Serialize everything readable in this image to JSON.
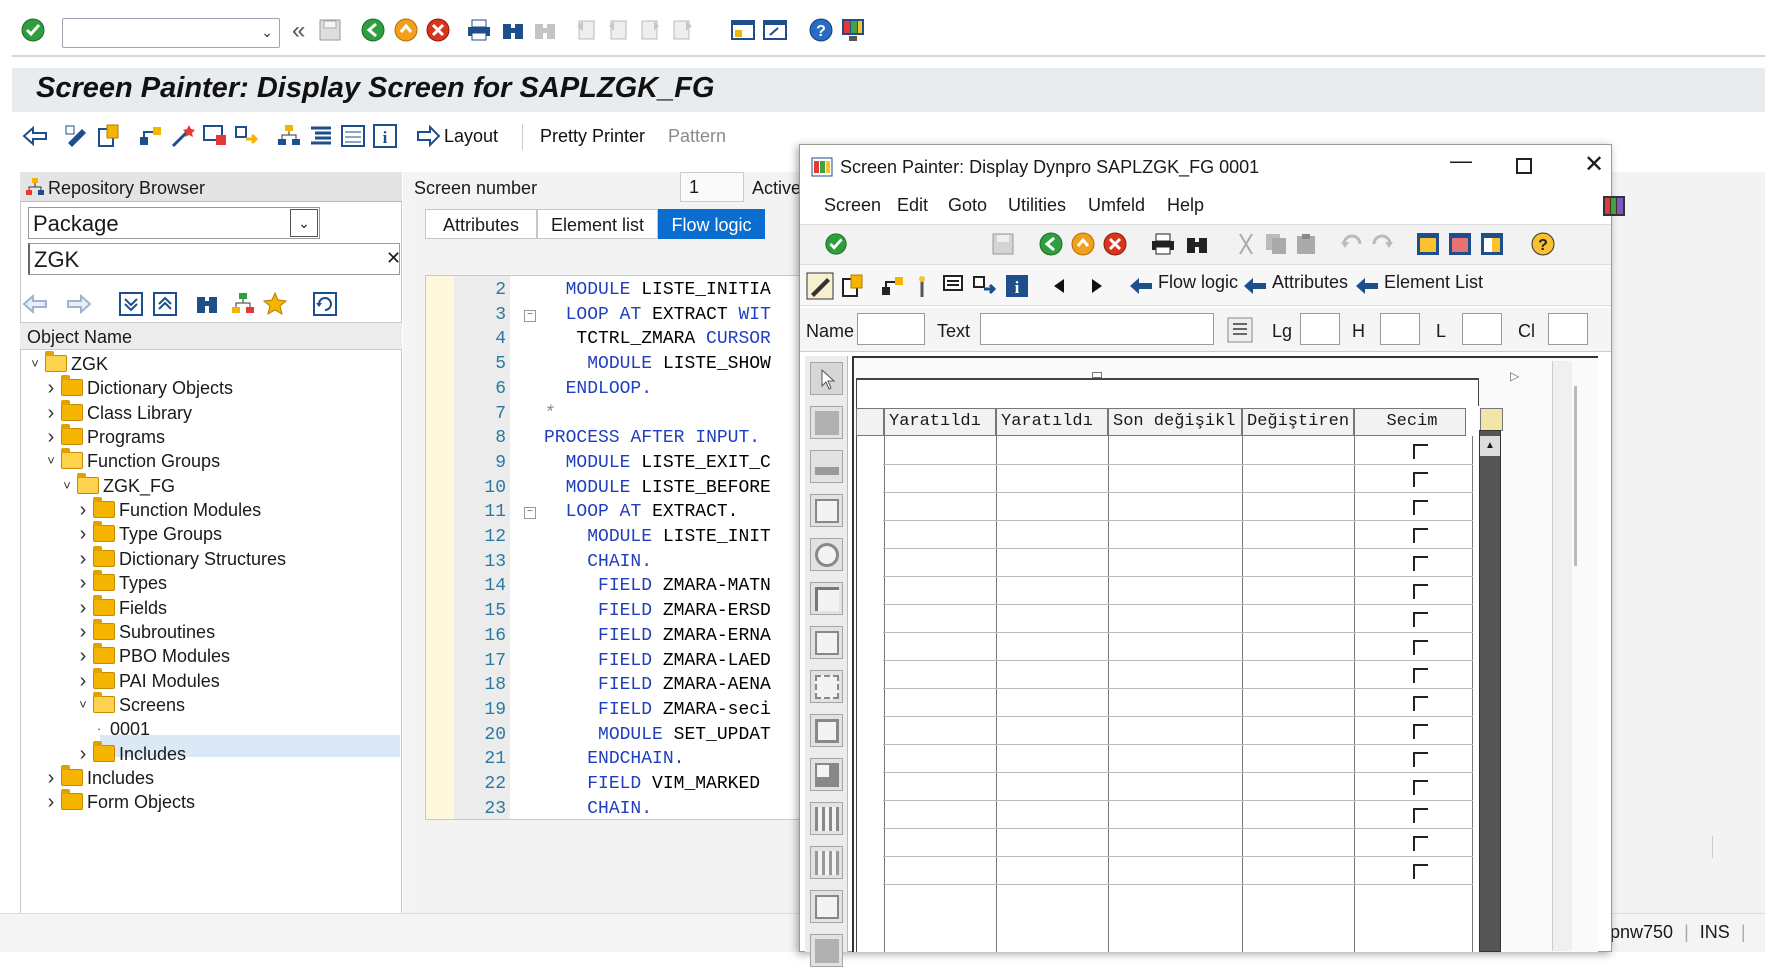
{
  "system_toolbar": {
    "command_field_value": "",
    "icons": [
      "enter-icon",
      "history-back-icon",
      "save-icon",
      "back-icon",
      "exit-icon",
      "cancel-icon",
      "print-icon",
      "find-icon",
      "find-next-icon",
      "first-page-icon",
      "prev-page-icon",
      "next-page-icon",
      "last-page-icon",
      "new-session-icon",
      "shortcut-icon",
      "help-icon",
      "layout-icon"
    ]
  },
  "title": "Screen Painter: Display Screen for SAPLZGK_FG",
  "app_toolbar": {
    "layout_label": "Layout",
    "pretty_printer_label": "Pretty Printer",
    "pattern_label": "Pattern"
  },
  "left_panel": {
    "header": "Repository Browser",
    "object_type": "Package",
    "object_name_value": "ZGK",
    "tree_header": "Object Name",
    "tree": [
      {
        "label": "ZGK",
        "level": 0,
        "expanded": true,
        "folder": true
      },
      {
        "label": "Dictionary Objects",
        "level": 1,
        "expanded": false,
        "folder": true
      },
      {
        "label": "Class Library",
        "level": 1,
        "expanded": false,
        "folder": true
      },
      {
        "label": "Programs",
        "level": 1,
        "expanded": false,
        "folder": true
      },
      {
        "label": "Function Groups",
        "level": 1,
        "expanded": true,
        "folder": true
      },
      {
        "label": "ZGK_FG",
        "level": 2,
        "expanded": true,
        "folder": true
      },
      {
        "label": "Function Modules",
        "level": 3,
        "expanded": false,
        "folder": true
      },
      {
        "label": "Type Groups",
        "level": 3,
        "expanded": false,
        "folder": true
      },
      {
        "label": "Dictionary Structures",
        "level": 3,
        "expanded": false,
        "folder": true
      },
      {
        "label": "Types",
        "level": 3,
        "expanded": false,
        "folder": true
      },
      {
        "label": "Fields",
        "level": 3,
        "expanded": false,
        "folder": true
      },
      {
        "label": "Subroutines",
        "level": 3,
        "expanded": false,
        "folder": true
      },
      {
        "label": "PBO Modules",
        "level": 3,
        "expanded": false,
        "folder": true
      },
      {
        "label": "PAI Modules",
        "level": 3,
        "expanded": false,
        "folder": true
      },
      {
        "label": "Screens",
        "level": 3,
        "expanded": true,
        "folder": true
      },
      {
        "label": "0001",
        "level": 4,
        "expanded": null,
        "folder": false,
        "selected": true
      },
      {
        "label": "Includes",
        "level": 3,
        "expanded": false,
        "folder": true
      },
      {
        "label": "Includes",
        "level": 1,
        "expanded": false,
        "folder": true
      },
      {
        "label": "Form Objects",
        "level": 1,
        "expanded": false,
        "folder": true
      }
    ]
  },
  "editor": {
    "screen_number_label": "Screen number",
    "screen_number_value": "1",
    "status_label": "Active",
    "tabs": [
      {
        "label": "Attributes",
        "selected": false
      },
      {
        "label": "Element list",
        "selected": false
      },
      {
        "label": "Flow logic",
        "selected": true
      }
    ],
    "lines": [
      {
        "n": "2",
        "text": "  MODULE LISTE_INITIA",
        "fold": false
      },
      {
        "n": "3",
        "text": "  LOOP AT EXTRACT WIT",
        "fold": true
      },
      {
        "n": "4",
        "text": "   TCTRL_ZMARA CURSOR",
        "fold": false
      },
      {
        "n": "5",
        "text": "    MODULE LISTE_SHOW",
        "fold": false
      },
      {
        "n": "6",
        "text": "  ENDLOOP.",
        "fold": false
      },
      {
        "n": "7",
        "text": "*",
        "fold": false
      },
      {
        "n": "8",
        "text": "PROCESS AFTER INPUT.",
        "fold": false
      },
      {
        "n": "9",
        "text": "  MODULE LISTE_EXIT_C",
        "fold": false
      },
      {
        "n": "10",
        "text": "  MODULE LISTE_BEFORE",
        "fold": false
      },
      {
        "n": "11",
        "text": "  LOOP AT EXTRACT.",
        "fold": true
      },
      {
        "n": "12",
        "text": "    MODULE LISTE_INIT",
        "fold": false
      },
      {
        "n": "13",
        "text": "    CHAIN.",
        "fold": false
      },
      {
        "n": "14",
        "text": "     FIELD ZMARA-MATN",
        "fold": false
      },
      {
        "n": "15",
        "text": "     FIELD ZMARA-ERSD",
        "fold": false
      },
      {
        "n": "16",
        "text": "     FIELD ZMARA-ERNA",
        "fold": false
      },
      {
        "n": "17",
        "text": "     FIELD ZMARA-LAED",
        "fold": false
      },
      {
        "n": "18",
        "text": "     FIELD ZMARA-AENA",
        "fold": false
      },
      {
        "n": "19",
        "text": "     FIELD ZMARA-seci",
        "fold": false
      },
      {
        "n": "20",
        "text": "     MODULE SET_UPDAT",
        "fold": false
      },
      {
        "n": "21",
        "text": "    ENDCHAIN.",
        "fold": false
      },
      {
        "n": "22",
        "text": "    FIELD VIM_MARKED",
        "fold": false
      },
      {
        "n": "23",
        "text": "    CHAIN.",
        "fold": false
      }
    ]
  },
  "dialog": {
    "title": "Screen Painter:  Display Dynpro SAPLZGK_FG 0001",
    "menu": [
      "Screen",
      "Edit",
      "Goto",
      "Utilities",
      "Umfeld",
      "Help"
    ],
    "toolbar2": {
      "flow_logic_label": "Flow logic",
      "attributes_label": "Attributes",
      "element_list_label": "Element List"
    },
    "attr_labels": {
      "name": "Name",
      "text": "Text",
      "lg": "Lg",
      "h": "H",
      "l": "L",
      "cl": "Cl"
    },
    "table_columns": [
      "Yaratıldı",
      "Yaratıldı",
      "Son değişikl",
      "Değiştiren",
      "Secim"
    ],
    "row_count": 16
  },
  "status_bar": {
    "server": "pnw750",
    "mode": "INS"
  }
}
